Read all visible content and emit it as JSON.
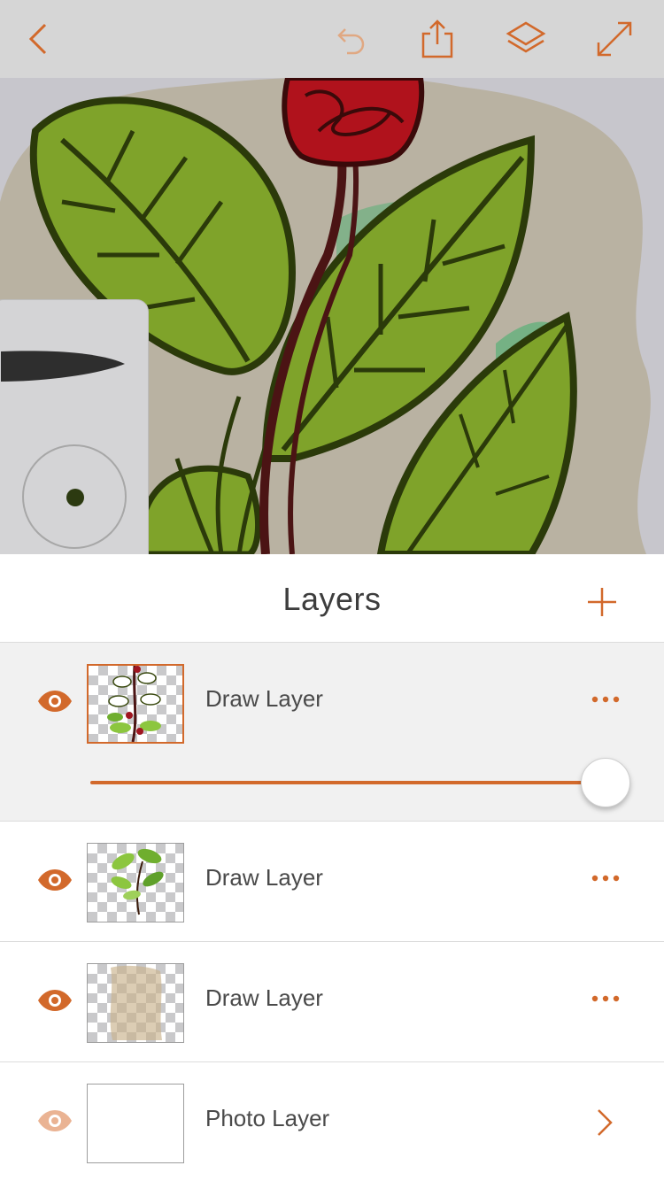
{
  "toolbar": {
    "back_icon": "chevron-left-icon",
    "undo_icon": "undo-icon",
    "share_icon": "share-icon",
    "layers_icon": "layers-icon",
    "fullscreen_icon": "expand-icon"
  },
  "colors": {
    "accent": "#d2692b",
    "toolbar_bg": "#d6d6d6",
    "canvas_bg": "#c7c6cc",
    "selected_row_bg": "#f1f1f1"
  },
  "layers_panel": {
    "title": "Layers",
    "add_icon": "plus-icon",
    "layers": [
      {
        "name": "Draw Layer",
        "visible": true,
        "selected": true,
        "opacity": 1.0,
        "thumbnail": "flower-vine",
        "action_icon": "more-icon"
      },
      {
        "name": "Draw Layer",
        "visible": true,
        "selected": false,
        "thumbnail": "green-leaves",
        "action_icon": "more-icon"
      },
      {
        "name": "Draw Layer",
        "visible": true,
        "selected": false,
        "thumbnail": "beige-wash",
        "action_icon": "more-icon"
      },
      {
        "name": "Photo Layer",
        "visible": true,
        "dimmed": true,
        "selected": false,
        "thumbnail": "blank",
        "action_icon": "chevron-right-icon"
      }
    ]
  }
}
